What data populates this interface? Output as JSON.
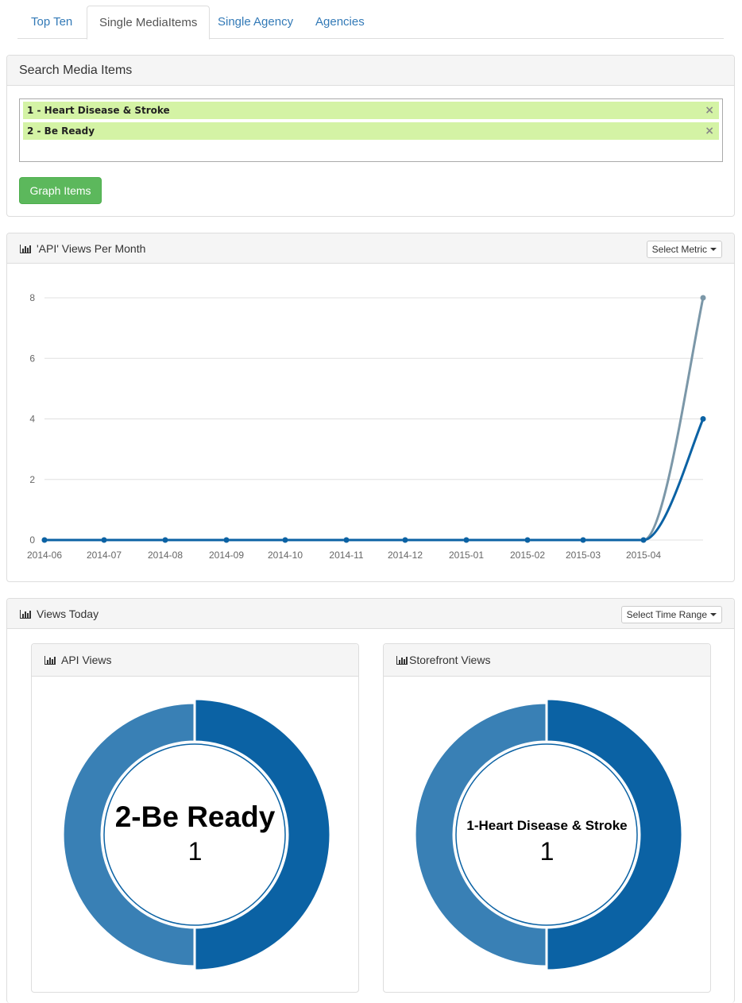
{
  "tabs": [
    {
      "label": "Top Ten",
      "active": false
    },
    {
      "label": "Single MediaItems",
      "active": true
    },
    {
      "label": "Single Agency",
      "active": false
    },
    {
      "label": "Agencies",
      "active": false
    }
  ],
  "search_panel": {
    "title": "Search Media Items",
    "selected_items": [
      "1 - Heart Disease & Stroke",
      "2 - Be Ready"
    ],
    "remove_glyph": "×",
    "graph_button": "Graph Items"
  },
  "views_panel": {
    "title": "'API' Views Per Month",
    "metric_button": "Select Metric",
    "icon": "bar-chart-icon"
  },
  "chart_data": {
    "type": "line",
    "x": [
      "2014-06",
      "2014-07",
      "2014-08",
      "2014-09",
      "2014-10",
      "2014-11",
      "2014-12",
      "2015-01",
      "2015-02",
      "2015-03",
      "2015-04",
      "2015-05"
    ],
    "x_tick_labels": [
      "2014-06",
      "2014-07",
      "2014-08",
      "2014-09",
      "2014-10",
      "2014-11",
      "2014-12",
      "2015-01",
      "2015-02",
      "2015-03",
      "2015-04"
    ],
    "y_ticks": [
      0,
      2,
      4,
      6,
      8
    ],
    "ylim": [
      0,
      8
    ],
    "grid": true,
    "series": [
      {
        "values": [
          0,
          0,
          0,
          0,
          0,
          0,
          0,
          0,
          0,
          0,
          0,
          8
        ],
        "color": "#7b97a8"
      },
      {
        "values": [
          0,
          0,
          0,
          0,
          0,
          0,
          0,
          0,
          0,
          0,
          0,
          4
        ],
        "color": "#0b62a4"
      }
    ]
  },
  "today_panel": {
    "title": "Views Today",
    "time_button": "Select Time Range",
    "donuts": [
      {
        "title": "API Views",
        "center_label": "2-Be Ready",
        "center_value": "1",
        "slices": [
          {
            "label": "2-Be Ready",
            "value": 1,
            "color": "#0b62a4"
          },
          {
            "label": "1-Heart Disease & Stroke",
            "value": 1,
            "color": "#3980b5"
          }
        ]
      },
      {
        "title": "Storefront Views",
        "center_label": "1-Heart Disease & Stroke",
        "center_value": "1",
        "slices": [
          {
            "label": "2-Be Ready",
            "value": 1,
            "color": "#0b62a4"
          },
          {
            "label": "1-Heart Disease & Stroke",
            "value": 1,
            "color": "#3980b5"
          }
        ]
      }
    ]
  }
}
